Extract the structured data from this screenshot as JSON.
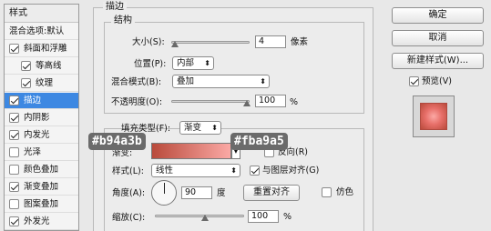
{
  "sidebar": {
    "title": "样式",
    "blend_options": "混合选项:默认",
    "items": [
      {
        "label": "斜面和浮雕",
        "checked": true,
        "indent": false,
        "selected": false
      },
      {
        "label": "等高线",
        "checked": true,
        "indent": true,
        "selected": false
      },
      {
        "label": "纹理",
        "checked": true,
        "indent": true,
        "selected": false
      },
      {
        "label": "描边",
        "checked": true,
        "indent": false,
        "selected": true
      },
      {
        "label": "内阴影",
        "checked": true,
        "indent": false,
        "selected": false
      },
      {
        "label": "内发光",
        "checked": true,
        "indent": false,
        "selected": false
      },
      {
        "label": "光泽",
        "checked": false,
        "indent": false,
        "selected": false
      },
      {
        "label": "颜色叠加",
        "checked": false,
        "indent": false,
        "selected": false
      },
      {
        "label": "渐变叠加",
        "checked": true,
        "indent": false,
        "selected": false
      },
      {
        "label": "图案叠加",
        "checked": false,
        "indent": false,
        "selected": false
      },
      {
        "label": "外发光",
        "checked": true,
        "indent": false,
        "selected": false
      }
    ]
  },
  "stroke": {
    "title": "描边",
    "structure": {
      "title": "结构",
      "size_label": "大小(S):",
      "size_value": "4",
      "size_unit": "像素",
      "position_label": "位置(P):",
      "position_value": "内部",
      "blend_label": "混合模式(B):",
      "blend_value": "叠加",
      "opacity_label": "不透明度(O):",
      "opacity_value": "100",
      "opacity_unit": "%"
    },
    "fill": {
      "fill_type_label": "填充类型(F):",
      "fill_type_value": "渐变",
      "gradient_label": "渐变:",
      "reverse_label": "反向(R)",
      "reverse_checked": false,
      "style_label": "样式(L):",
      "style_value": "线性",
      "align_label": "与图层对齐(G)",
      "align_checked": true,
      "angle_label": "角度(A):",
      "angle_value": "90",
      "angle_unit": "度",
      "reset_align_label": "重置对齐",
      "dither_label": "仿色",
      "dither_checked": false,
      "scale_label": "缩放(C):",
      "scale_value": "100",
      "scale_unit": "%",
      "gradient_start_color": "#b94a3b",
      "gradient_end_color": "#fba9a5",
      "start_tag": "#b94a3b",
      "end_tag": "#fba9a5"
    }
  },
  "buttons": {
    "ok": "确定",
    "cancel": "取消",
    "new_style": "新建样式(W)...",
    "preview_label": "预览(V)",
    "preview_checked": true
  },
  "colors": {
    "selection": "#3d88e2",
    "preview_swatch": "#e8706a"
  }
}
